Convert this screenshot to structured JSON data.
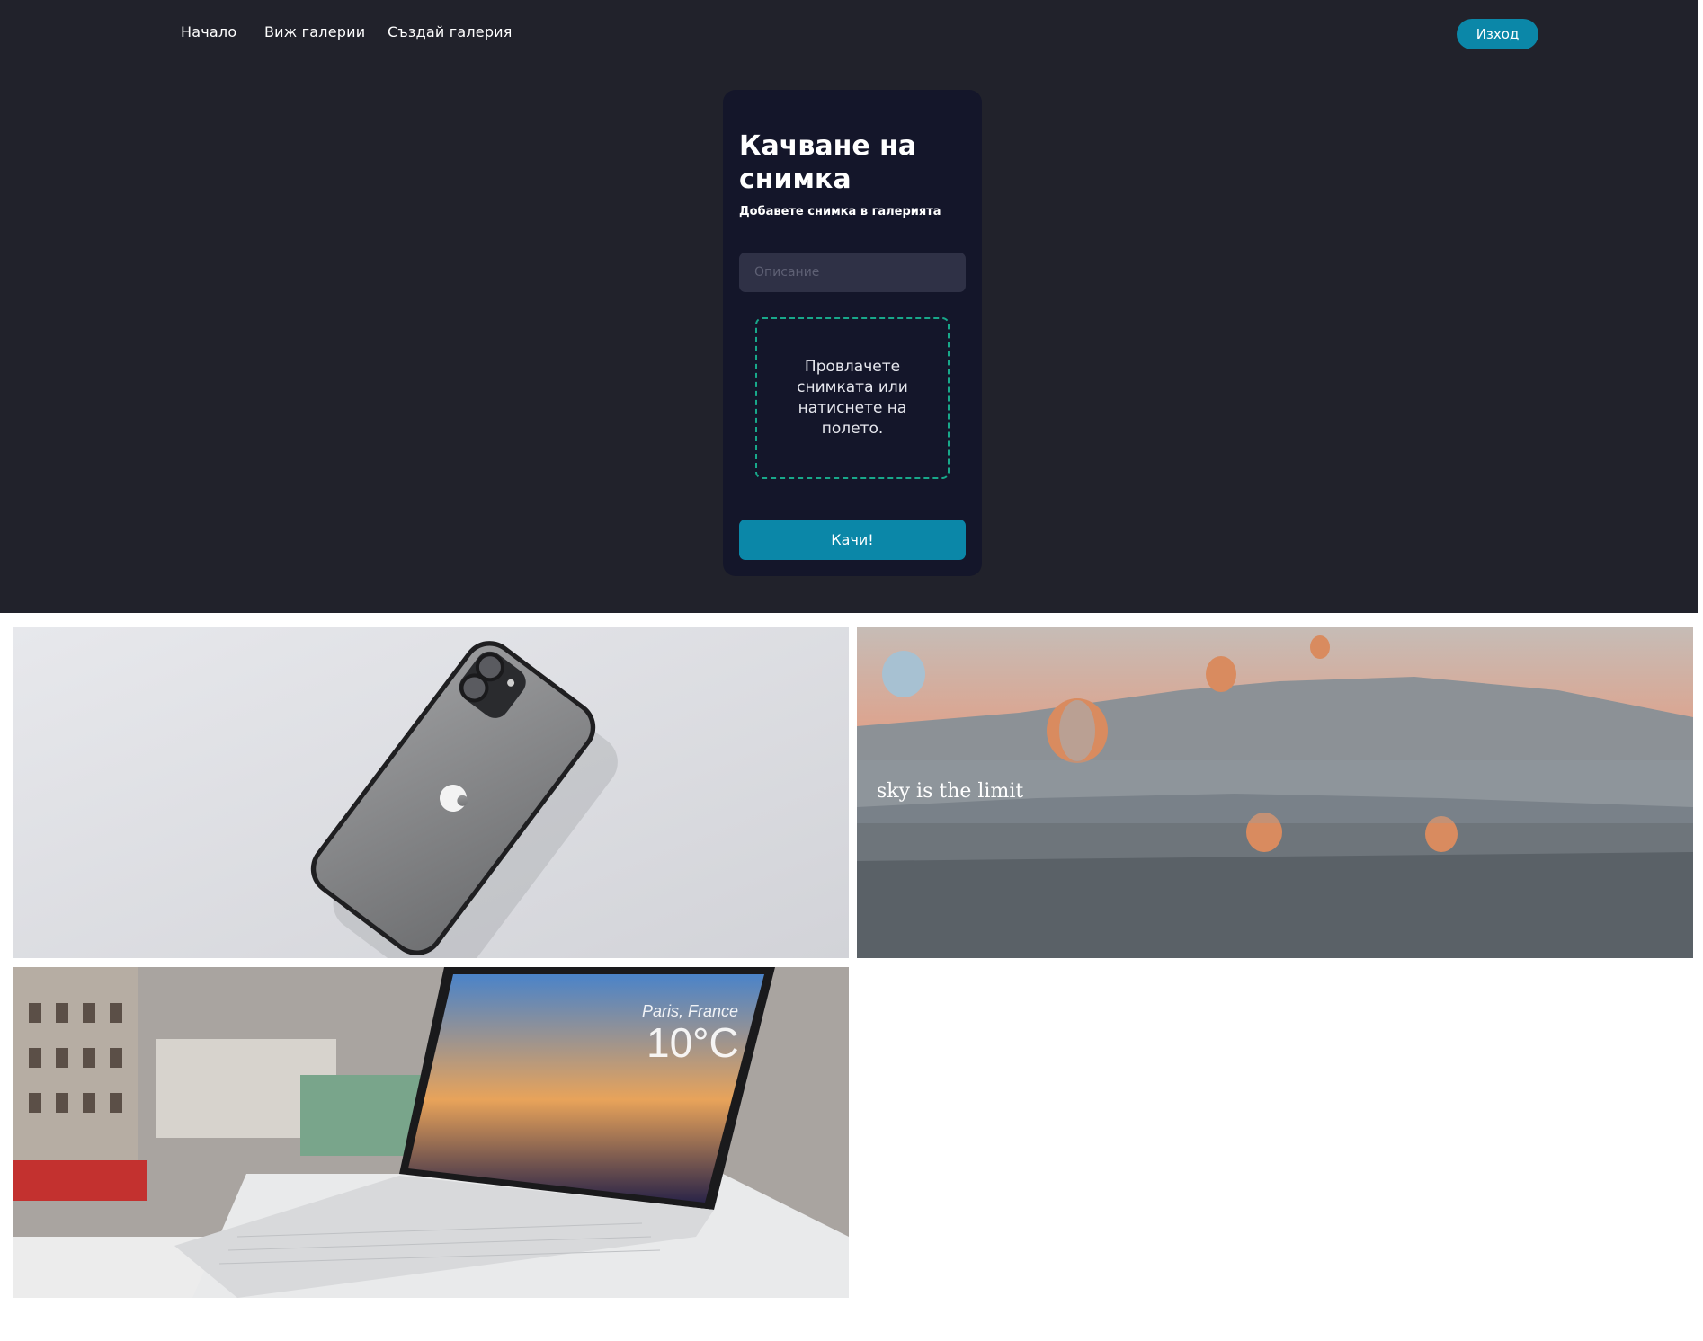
{
  "nav": {
    "links": [
      {
        "label": "Начало"
      },
      {
        "label": "Виж галерии"
      },
      {
        "label": "Създай галерия"
      }
    ],
    "logout_label": "Изход"
  },
  "upload": {
    "title": "Качване на снимка",
    "subtitle": "Добавете снимка в галерията",
    "description_placeholder": "Описание",
    "dropzone_text": "Провлачете снимката или натиснете на полето.",
    "submit_label": "Качи!"
  },
  "gallery": {
    "items": [
      {
        "image": "black-smartphone-on-grey-surface",
        "caption": ""
      },
      {
        "image": "hot-air-balloons-over-valley",
        "caption": "sky is the limit"
      },
      {
        "image": "silver-laptop-showing-weather-paris-france",
        "caption": "",
        "screen": {
          "city": "Paris, France",
          "temp": "10°C"
        }
      }
    ]
  },
  "colors": {
    "hero_bg": "#21222b",
    "card_bg": "#14162a",
    "accent": "#0b87a8",
    "dropzone_border": "#18a88a",
    "input_bg": "#2f3146"
  }
}
